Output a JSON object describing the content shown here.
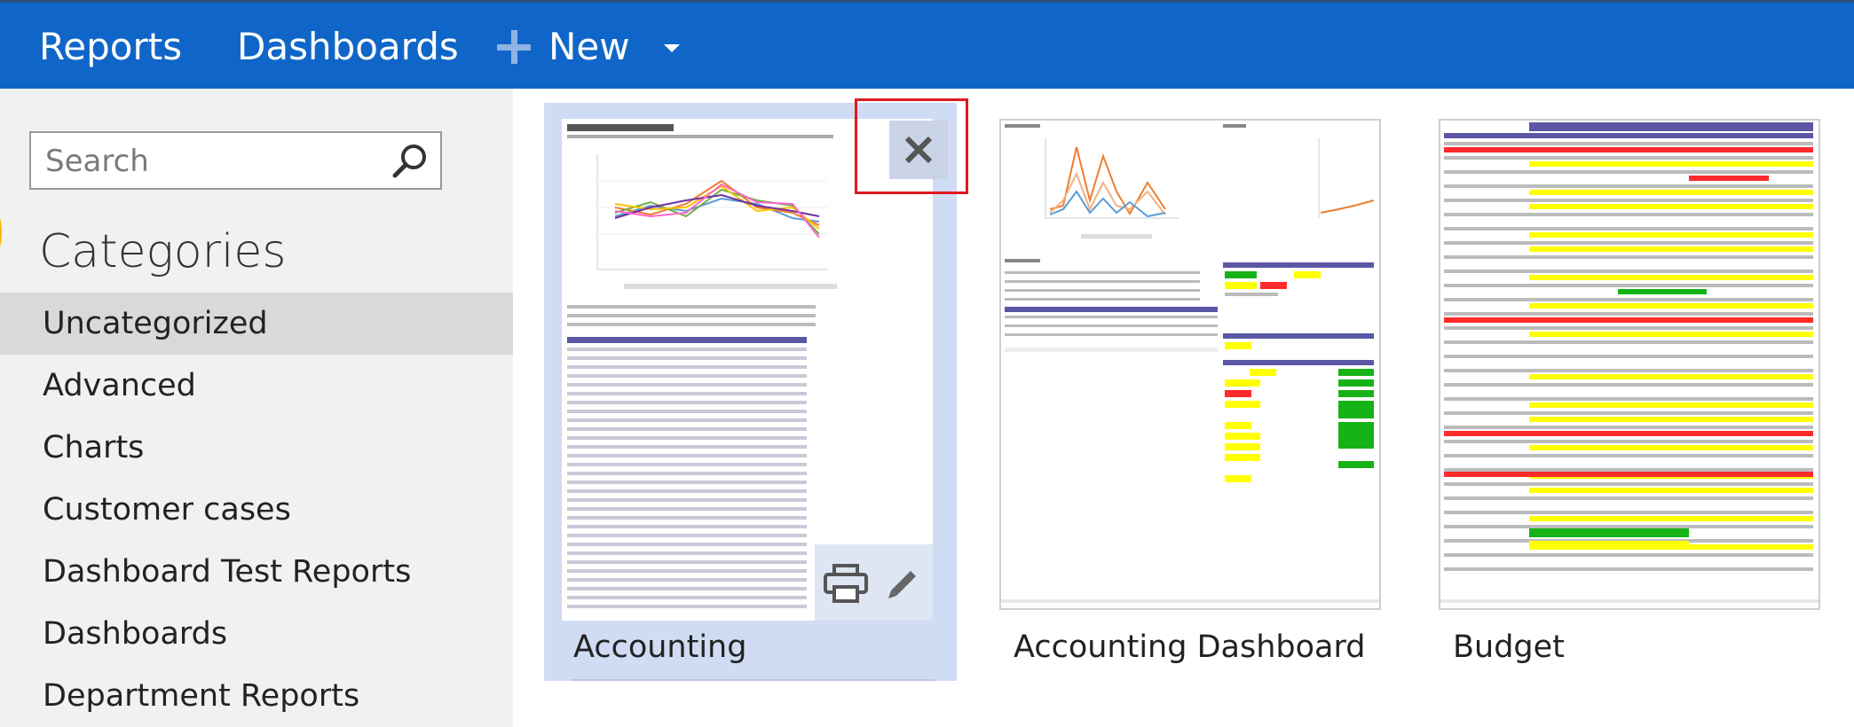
{
  "topbar": {
    "reports_label": "Reports",
    "dashboards_label": "Dashboards",
    "new_label": "New",
    "icons": [
      "plus-icon",
      "chevron-down-icon"
    ],
    "background": "#1066c8"
  },
  "sidebar": {
    "search": {
      "placeholder": "Search",
      "value": ""
    },
    "categories_title": "Categories",
    "items": [
      {
        "label": "Uncategorized",
        "selected": true
      },
      {
        "label": "Advanced",
        "selected": false
      },
      {
        "label": "Charts",
        "selected": false
      },
      {
        "label": "Customer cases",
        "selected": false
      },
      {
        "label": "Dashboard Test Reports",
        "selected": false
      },
      {
        "label": "Dashboards",
        "selected": false
      },
      {
        "label": "Department Reports",
        "selected": false
      }
    ]
  },
  "reports": [
    {
      "title": "Accounting",
      "active": true,
      "actions": [
        "close-icon",
        "print-icon",
        "pencil-icon"
      ]
    },
    {
      "title": "Accounting Dashboard",
      "active": false
    },
    {
      "title": "Budget",
      "active": false
    }
  ],
  "colors": {
    "accent": "#1066c8",
    "selected_tile": "#cfdcf3",
    "highlight": "#e0191f",
    "thumb_table_header": "#5b57a5",
    "budget_yellow": "#ffff00",
    "budget_red": "#ff2a2a",
    "budget_green": "#16b316"
  }
}
